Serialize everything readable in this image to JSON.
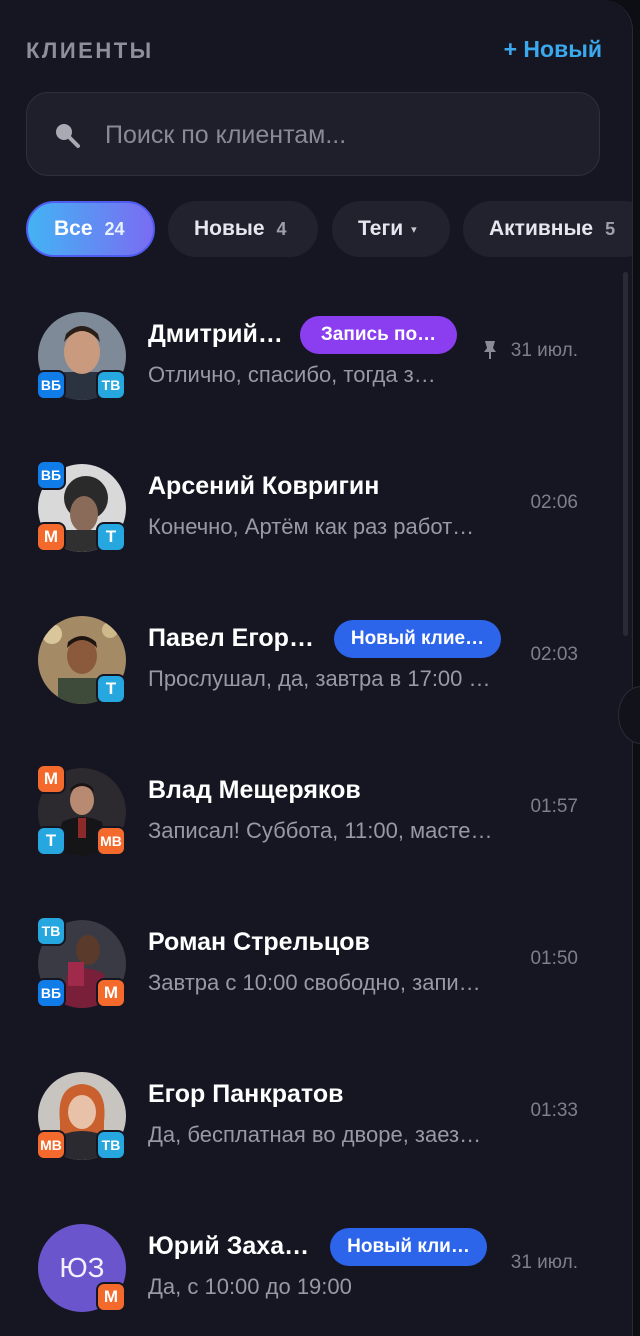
{
  "header": {
    "title": "КЛИЕНТЫ",
    "new_button": "+ Новый"
  },
  "search": {
    "placeholder": "Поиск по клиентам..."
  },
  "filters": [
    {
      "label": "Все",
      "count": "24",
      "active": true
    },
    {
      "label": "Новые",
      "count": "4"
    },
    {
      "label": "Теги",
      "caret": "▾"
    },
    {
      "label": "Активные",
      "count": "5"
    }
  ],
  "clients": [
    {
      "name": "Дмитрий…",
      "tag": "Запись по…",
      "preview": "Отлично, спасибо, тогда з…",
      "time": "31 июл.",
      "pinned": true,
      "badges": [
        "ВБ",
        "ТВ"
      ]
    },
    {
      "name": "Арсений Ковригин",
      "preview": "Конечно, Артём как раз работ…",
      "time": "02:06",
      "badges": [
        "ВБ",
        "М",
        "Т"
      ]
    },
    {
      "name": "Павел Егор…",
      "tag": "Новый клие…",
      "preview": "Прослушал, да, завтра в 17:00 …",
      "time": "02:03",
      "badges": [
        "Т"
      ]
    },
    {
      "name": "Влад Мещеряков",
      "preview": "Записал! Суббота, 11:00, масте…",
      "time": "01:57",
      "badges": [
        "М",
        "Т",
        "МВ"
      ]
    },
    {
      "name": "Роман Стрельцов",
      "preview": "Завтра с 10:00 свободно, запи…",
      "time": "01:50",
      "badges": [
        "ТВ",
        "ВБ",
        "М"
      ]
    },
    {
      "name": "Егор Панкратов",
      "preview": "Да, бесплатная во дворе, заез…",
      "time": "01:33",
      "badges": [
        "МВ",
        "ТВ"
      ]
    },
    {
      "name": "Юрий Заха…",
      "initials": "ЮЗ",
      "tag": "Новый кли…",
      "preview": "Да, с 10:00 до 19:00",
      "time": "31 июл.",
      "badges": [
        "М"
      ]
    }
  ],
  "colors": {
    "accent": "#3ba9ee",
    "tag_purple": "#8a3ef0",
    "tag_blue": "#2c64ea",
    "vk": "#0f7ce8",
    "telegram": "#26a7e0",
    "max": "#f46a2c"
  }
}
